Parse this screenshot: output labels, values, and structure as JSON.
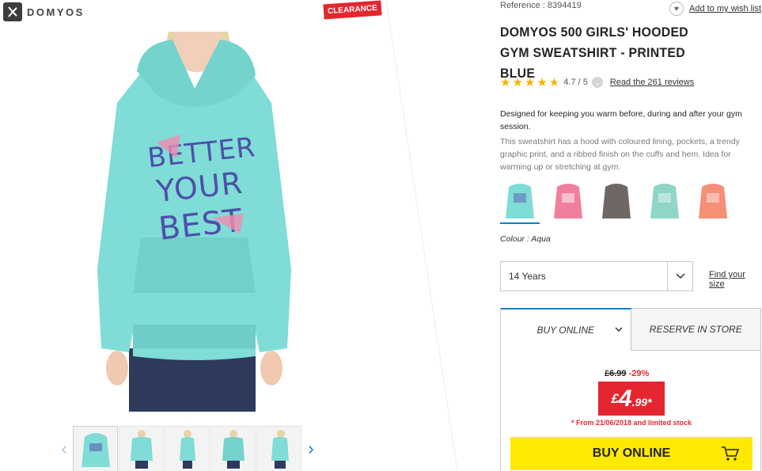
{
  "brand": {
    "logo_text": "DOMYOS"
  },
  "badge": {
    "clearance": "CLEARANCE"
  },
  "product": {
    "reference": "Reference : 8394419",
    "wishlist": "Add to my wish list",
    "title": "DOMYOS 500 GIRLS' HOODED GYM SWEATSHIRT - PRINTED BLUE",
    "rating": {
      "stars": 4.7,
      "score_text": "4.7 / 5",
      "reviews_link": "Read the 261 reviews"
    },
    "description_lead": "Designed for keeping you warm before, during and after your gym session.",
    "description": "This sweatshirt has a hood with coloured lining, pockets, a trendy graphic print, and a ribbed finish on the cuffs and hem. Idea for warming up or stretching at gym.",
    "color_label": "Colour : Aqua",
    "swatches": [
      {
        "name": "aqua",
        "color": "#7fdcd6",
        "selected": true
      },
      {
        "name": "pink",
        "color": "#f07f9c",
        "selected": false
      },
      {
        "name": "grey",
        "color": "#6e6763",
        "selected": false
      },
      {
        "name": "mint",
        "color": "#8fd5c8",
        "selected": false
      },
      {
        "name": "coral",
        "color": "#f58f77",
        "selected": false
      }
    ],
    "size": {
      "selected": "14 Years",
      "find_size_link": "Find your size"
    }
  },
  "purchase": {
    "tabs": [
      {
        "label": "BUY ONLINE",
        "active": true
      },
      {
        "label": "RESERVE IN STORE",
        "active": false
      }
    ],
    "old_price": "£6.99",
    "discount": "-29%",
    "price": {
      "currency": "£",
      "integer": "4",
      "decimal": ".99*"
    },
    "promo_note": "* From 21/06/2018 and limited stock",
    "buy_button": "BUY ONLINE"
  },
  "colors": {
    "accent_blue": "#0082c3",
    "sale_red": "#e3262f",
    "buy_yellow": "#fee900",
    "star": "#f5b400",
    "hoodie": "#7fdcd6"
  }
}
